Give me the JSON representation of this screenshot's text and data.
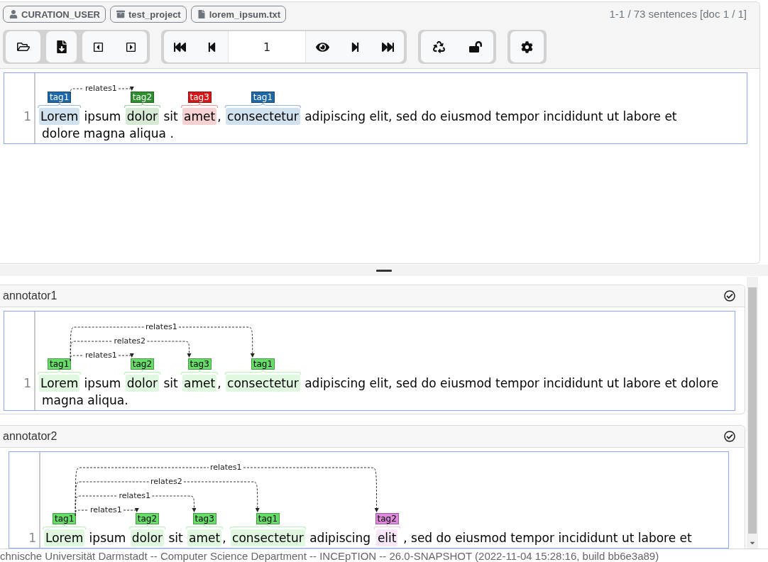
{
  "header": {
    "badges": [
      {
        "kind": "user",
        "label": "CURATION_USER"
      },
      {
        "kind": "project",
        "label": "test_project"
      },
      {
        "kind": "document",
        "label": "lorem_ipsum.txt"
      }
    ],
    "position": "1-1 / 73 sentences [doc 1 / 1]"
  },
  "toolbar": {
    "sentence_field": {
      "value": "1"
    }
  },
  "editor": {
    "sentences": [
      {
        "number": "1",
        "relations": [
          {
            "label": "relates1"
          }
        ],
        "lines": [
          [
            {
              "kind": "annotation",
              "text": "Lorem",
              "tag": "tag1",
              "color": "#1f68a8"
            },
            {
              "kind": "text",
              "text": " ipsum "
            },
            {
              "kind": "annotation",
              "text": "dolor",
              "tag": "tag2",
              "color": "#2d8f2d"
            },
            {
              "kind": "text",
              "text": " sit "
            },
            {
              "kind": "annotation",
              "text": "amet",
              "tag": "tag3",
              "color": "#d41818"
            },
            {
              "kind": "text",
              "text": ", "
            },
            {
              "kind": "annotation",
              "text": "consectetur",
              "tag": "tag1",
              "color": "#1f68a8"
            },
            {
              "kind": "text",
              "text": " adipiscing elit, sed do eiusmod tempor incididunt ut labore et"
            }
          ],
          [
            {
              "kind": "text",
              "text": "dolore magna aliqua ."
            }
          ]
        ]
      }
    ]
  },
  "annotators": [
    {
      "name": "annotator1",
      "sentences": [
        {
          "number": "1",
          "relations": [
            {
              "label": "relates1"
            },
            {
              "label": "relates2"
            },
            {
              "label": "relates1"
            }
          ],
          "lines": [
            [
              {
                "kind": "annotation",
                "text": "Lorem",
                "tag": "tag1",
                "color": "#66dd66"
              },
              {
                "kind": "text",
                "text": " ipsum "
              },
              {
                "kind": "annotation",
                "text": "dolor",
                "tag": "tag2",
                "color": "#66dd66"
              },
              {
                "kind": "text",
                "text": " sit "
              },
              {
                "kind": "annotation",
                "text": "amet",
                "tag": "tag3",
                "color": "#66dd66"
              },
              {
                "kind": "text",
                "text": ", "
              },
              {
                "kind": "annotation",
                "text": "consectetur",
                "tag": "tag1",
                "color": "#66dd66"
              },
              {
                "kind": "text",
                "text": " adipiscing elit, sed do eiusmod tempor incididunt ut labore et dolore"
              }
            ],
            [
              {
                "kind": "text",
                "text": "magna aliqua."
              }
            ]
          ]
        }
      ]
    },
    {
      "name": "annotator2",
      "sentences": [
        {
          "number": "1",
          "relations": [
            {
              "label": "relates1"
            },
            {
              "label": "relates2"
            },
            {
              "label": "relates1"
            },
            {
              "label": "relates1"
            }
          ],
          "lines": [
            [
              {
                "kind": "annotation",
                "text": "Lorem",
                "tag": "tag1",
                "color": "#66dd66"
              },
              {
                "kind": "text",
                "text": " ipsum "
              },
              {
                "kind": "annotation",
                "text": "dolor",
                "tag": "tag2",
                "color": "#66dd66"
              },
              {
                "kind": "text",
                "text": " sit "
              },
              {
                "kind": "annotation",
                "text": "amet",
                "tag": "tag3",
                "color": "#66dd66"
              },
              {
                "kind": "text",
                "text": ", "
              },
              {
                "kind": "annotation",
                "text": "consectetur",
                "tag": "tag1",
                "color": "#66dd66"
              },
              {
                "kind": "text",
                "text": " adipiscing "
              },
              {
                "kind": "annotation",
                "text": "elit",
                "tag": "tag2",
                "color": "#dd88dd"
              },
              {
                "kind": "text",
                "text": " , sed do eiusmod tempor incididunt ut labore et"
              }
            ]
          ]
        }
      ]
    }
  ],
  "footer": "chnische Universität Darmstadt -- Computer Science Department -- INCEpTION -- 26.0-SNAPSHOT (2022-11-04 15:28:16, build bb6e3a89)"
}
